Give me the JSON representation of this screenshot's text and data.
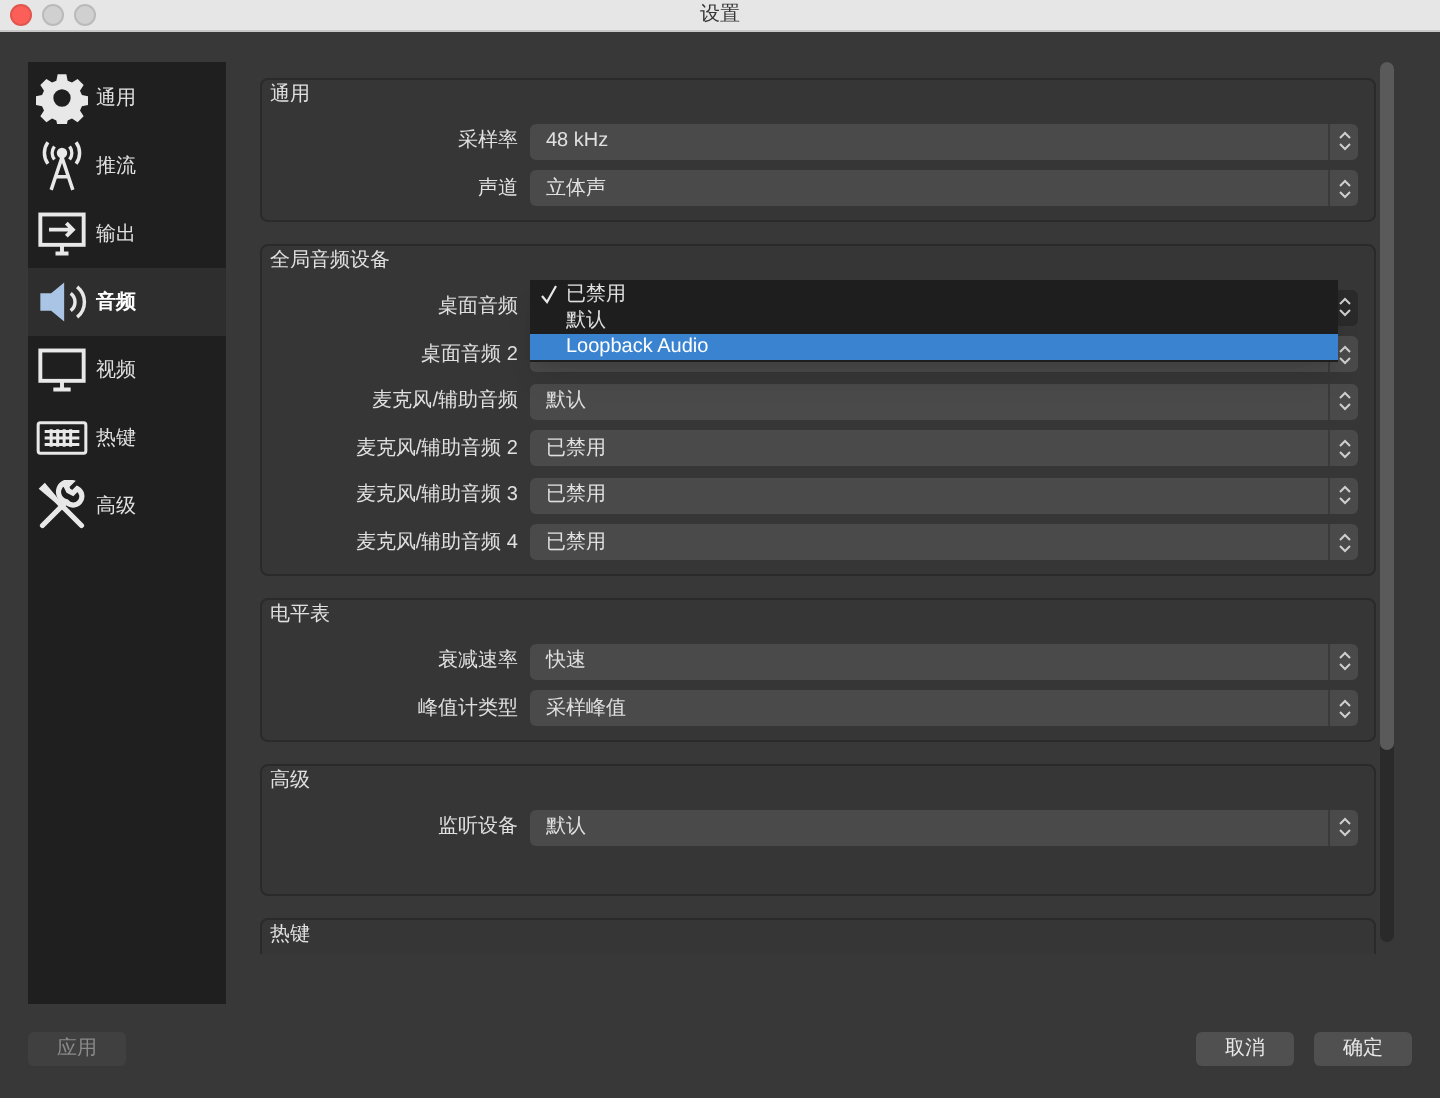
{
  "window": {
    "title": "设置"
  },
  "sidebar": {
    "items": [
      {
        "label": "通用",
        "selected": false
      },
      {
        "label": "推流",
        "selected": false
      },
      {
        "label": "输出",
        "selected": false
      },
      {
        "label": "音频",
        "selected": true
      },
      {
        "label": "视频",
        "selected": false
      },
      {
        "label": "热键",
        "selected": false
      },
      {
        "label": "高级",
        "selected": false
      }
    ]
  },
  "sections": [
    {
      "title": "通用",
      "rows": [
        {
          "label": "采样率",
          "value": "48 kHz"
        },
        {
          "label": "声道",
          "value": "立体声"
        }
      ]
    },
    {
      "title": "全局音频设备",
      "rows": [
        {
          "label": "桌面音频",
          "dropdown": {
            "options": [
              {
                "label": "已禁用",
                "checked": true,
                "highlighted": false
              },
              {
                "label": "默认",
                "checked": false,
                "highlighted": false
              },
              {
                "label": "Loopback Audio",
                "checked": false,
                "highlighted": true
              }
            ]
          }
        },
        {
          "label": "桌面音频 2"
        },
        {
          "label": "麦克风/辅助音频",
          "value": "默认"
        },
        {
          "label": "麦克风/辅助音频 2",
          "value": "已禁用"
        },
        {
          "label": "麦克风/辅助音频 3",
          "value": "已禁用"
        },
        {
          "label": "麦克风/辅助音频 4",
          "value": "已禁用"
        }
      ]
    },
    {
      "title": "电平表",
      "rows": [
        {
          "label": "衰减速率",
          "value": "快速"
        },
        {
          "label": "峰值计类型",
          "value": "采样峰值"
        }
      ]
    },
    {
      "title": "高级",
      "rows": [
        {
          "label": "监听设备",
          "value": "默认"
        }
      ]
    },
    {
      "title": "热键"
    }
  ],
  "buttons": [
    {
      "label": "应用",
      "disabled": true
    },
    {
      "label": "取消",
      "disabled": false
    },
    {
      "label": "确定",
      "disabled": false
    }
  ]
}
